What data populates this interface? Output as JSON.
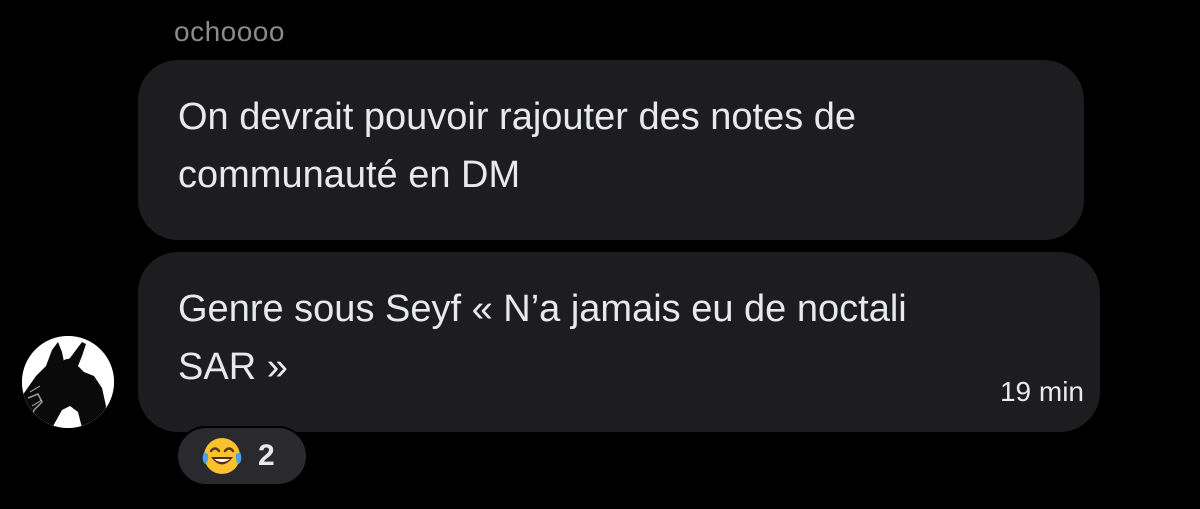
{
  "conversation": {
    "sender_name": "ochoooo",
    "messages": [
      {
        "text_lines": [
          "On devrait pouvoir rajouter des notes de",
          "communauté en DM"
        ]
      },
      {
        "text_lines": [
          "Genre sous Seyf « N’a jamais eu de noctali",
          "SAR »"
        ],
        "timestamp": "19 min"
      }
    ],
    "reaction": {
      "emoji": "face-with-tears-of-joy-icon",
      "count": "2"
    }
  },
  "colors": {
    "background": "#000000",
    "bubble": "#1d1d20",
    "text": "#e7e9ea",
    "sender_name": "#8b8b8b",
    "reaction_pill": "#2a2a2e"
  }
}
